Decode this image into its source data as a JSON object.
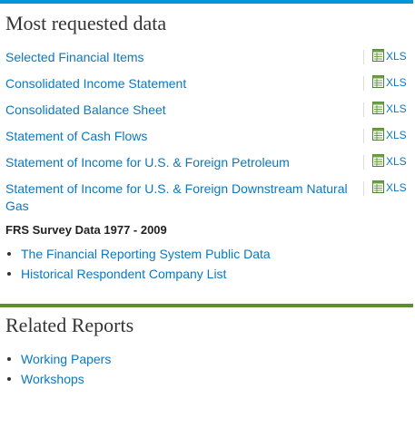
{
  "most_requested": {
    "title": "Most requested data",
    "rows": [
      {
        "label": "Selected Financial Items",
        "file": "XLS"
      },
      {
        "label": "Consolidated Income Statement",
        "file": "XLS"
      },
      {
        "label": "Consolidated Balance Sheet",
        "file": "XLS"
      },
      {
        "label": "Statement of Cash Flows",
        "file": "XLS"
      },
      {
        "label": "Statement of Income for U.S. & Foreign Petroleum",
        "file": "XLS"
      },
      {
        "label": "Statement of Income for U.S. & Foreign Downstream Natural Gas",
        "file": "XLS"
      }
    ]
  },
  "frs_survey": {
    "title": "FRS Survey Data 1977 - 2009",
    "links": [
      "The Financial Reporting System Public Data",
      "Historical Respondent Company List"
    ]
  },
  "related_reports": {
    "title": "Related Reports",
    "links": [
      "Working Papers",
      "Workshops"
    ]
  },
  "colors": {
    "accent_blue": "#0096d6",
    "accent_green": "#5a8f2d",
    "link": "#0a78c2"
  },
  "icons": {
    "file": "spreadsheet-file-icon"
  }
}
